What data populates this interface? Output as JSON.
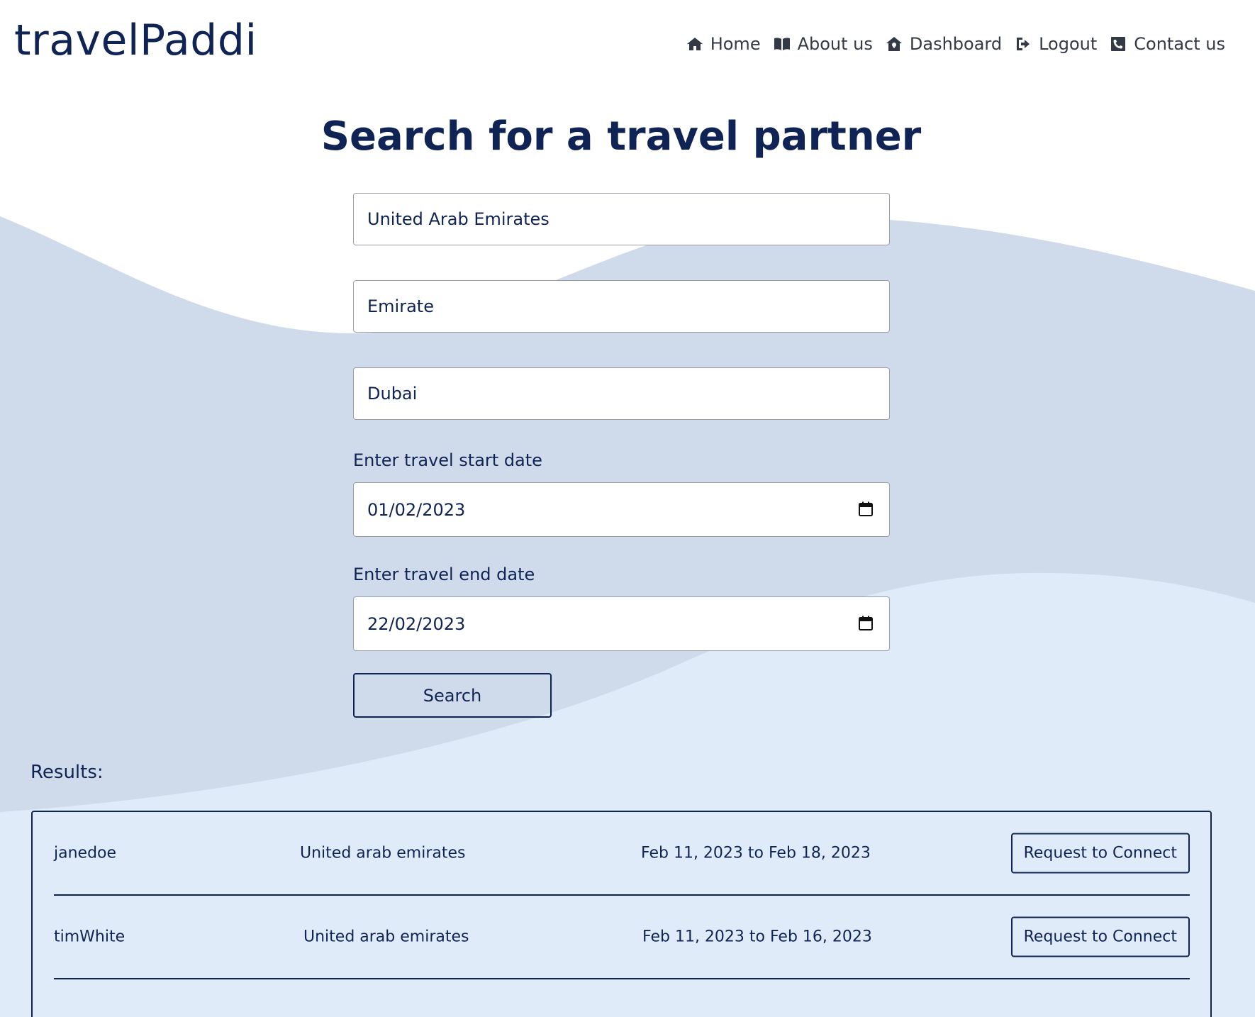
{
  "brand": {
    "name": "travelPaddi"
  },
  "nav": [
    {
      "label": "Home",
      "icon": "home-icon"
    },
    {
      "label": "About us",
      "icon": "book-icon"
    },
    {
      "label": "Dashboard",
      "icon": "dashboard-house-icon"
    },
    {
      "label": "Logout",
      "icon": "logout-icon"
    },
    {
      "label": "Contact us",
      "icon": "phone-icon"
    }
  ],
  "page_title": "Search for a travel partner",
  "form": {
    "country_value": "United Arab Emirates",
    "state_value": "Emirate",
    "city_value": "Dubai",
    "start_label": "Enter travel start date",
    "start_value": "01/02/2023",
    "end_label": "Enter travel end date",
    "end_value": "22/02/2023",
    "search_label": "Search"
  },
  "results": {
    "label": "Results:",
    "rows": [
      {
        "username": "janedoe",
        "country": "United arab emirates",
        "dates": "Feb 11, 2023 to Feb 18, 2023",
        "action": "Request to Connect"
      },
      {
        "username": "timWhite",
        "country": "United arab emirates",
        "dates": "Feb 11, 2023 to Feb 16, 2023",
        "action": "Request to Connect"
      }
    ]
  },
  "colors": {
    "primary": "#0f2454",
    "wave_dark": "#cfdaea",
    "wave_light": "#e0ebf9",
    "nav_text": "#333a45"
  }
}
